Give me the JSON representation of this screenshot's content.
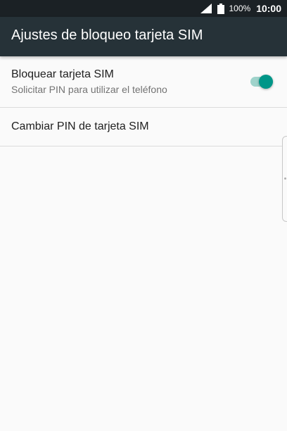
{
  "status_bar": {
    "battery_percent": "100%",
    "time": "10:00",
    "icons": [
      "signal-icon",
      "battery-icon"
    ]
  },
  "app_bar": {
    "title": "Ajustes de bloqueo tarjeta SIM"
  },
  "settings": {
    "lock_sim": {
      "title": "Bloquear tarjeta SIM",
      "summary": "Solicitar PIN para utilizar el teléfono",
      "enabled": true
    },
    "change_pin": {
      "title": "Cambiar PIN de tarjeta SIM"
    }
  },
  "colors": {
    "app_bar": "#263238",
    "status_bar": "#1b2125",
    "accent": "#009688",
    "background": "#fafafa"
  }
}
